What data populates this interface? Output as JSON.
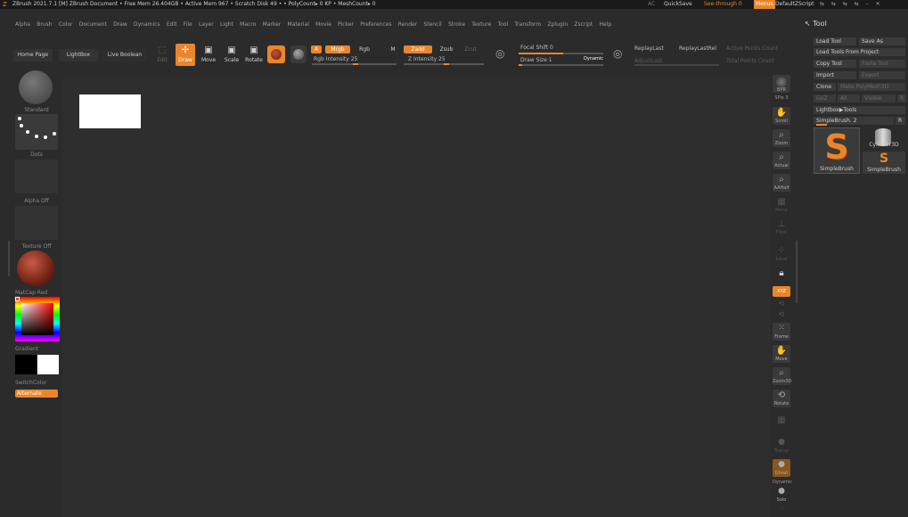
{
  "titlebar": {
    "app_title": "ZBrush 2021.7.1 [M]  ZBrush Document   • Free Mem 26.404GB • Active Mem 967 • Scratch Disk 49 •  • PolyCount▸ 0 KP  • MeshCount▸ 0",
    "ac_label": "AC",
    "quicksave": "QuickSave",
    "see_through": "See-through  0",
    "menus": "Menus",
    "default_script": "DefaultZScript"
  },
  "menubar": [
    "Alpha",
    "Brush",
    "Color",
    "Document",
    "Draw",
    "Dynamics",
    "Edit",
    "File",
    "Layer",
    "Light",
    "Macro",
    "Marker",
    "Material",
    "Movie",
    "Picker",
    "Preferences",
    "Render",
    "Stencil",
    "Stroke",
    "Texture",
    "Tool",
    "Transform",
    "Zplugin",
    "Zscript",
    "Help"
  ],
  "shelf": {
    "home_page": "Home Page",
    "lightbox": "LightBox",
    "live_boolean": "Live Boolean",
    "edit": "Edit",
    "draw": "Draw",
    "move": "Move",
    "scale": "Scale",
    "rotate": "Rotate",
    "a": "A",
    "mrgb": "Mrgb",
    "rgb": "Rgb",
    "m": "M",
    "rgb_intensity": "Rgb Intensity 25",
    "zadd": "Zadd",
    "zsub": "Zsub",
    "zcut": "Zcut",
    "z_intensity": "Z Intensity 25",
    "focal_shift": "Focal Shift 0",
    "draw_size": "Draw Size 1",
    "dynamic": "Dynamic",
    "replay_last": "ReplayLast",
    "replay_last_rel": "ReplayLastRel",
    "active_points": "Active Points Count",
    "adjust_last": "AdjustLast",
    "total_points": "Total Points Count",
    "rgb_intensity_value": 25,
    "z_intensity_value": 25
  },
  "left_shelf": {
    "standard": "Standard",
    "dots": "Dots",
    "alpha_off": "Alpha Off",
    "texture_off": "Texture Off",
    "matcap": "MatCap Red Wax",
    "gradient": "Gradient",
    "switch_color": "SwitchColor",
    "alternate": "Alternate"
  },
  "right_shelf": {
    "bpr": "BPR",
    "spix": "SPix 3",
    "scroll": "Scroll",
    "zoom": "Zoom",
    "actual": "Actual",
    "aahalf": "AAHalf",
    "persp": "Persp",
    "floor": "Floor",
    "local": "Local",
    "xyz": "XYZ",
    "frame": "Frame",
    "move": "Move",
    "zoom3d": "Zoom3D",
    "rotate": "Rotate",
    "polyf": "PolyF",
    "transp": "Transp",
    "ghost": "Ghost",
    "dynamic": "Dynamic",
    "solo": "Solo"
  },
  "tool_panel": {
    "header": "Tool",
    "load_tool": "Load Tool",
    "save_as": "Save As",
    "load_from_project": "Load Tools From Project",
    "copy_tool": "Copy Tool",
    "paste_tool": "Paste Tool",
    "import": "Import",
    "export": "Export",
    "clone": "Clone",
    "make_polymesh": "Make PolyMesh3D",
    "goz": "GoZ",
    "all": "All",
    "visible": "Visible",
    "r": "R",
    "lightbox_tools": "Lightbox▶Tools",
    "simplebrush_slider": "SimpleBrush. 2",
    "r2": "R",
    "thumb1_label": "SimpleBrush",
    "thumb2_label": "Cylinder3D",
    "thumb3_label": "SimpleBrush"
  },
  "colors": {
    "accent": "#e8862c",
    "background": "#2b2b2b",
    "canvas": "#2e2e2e"
  }
}
